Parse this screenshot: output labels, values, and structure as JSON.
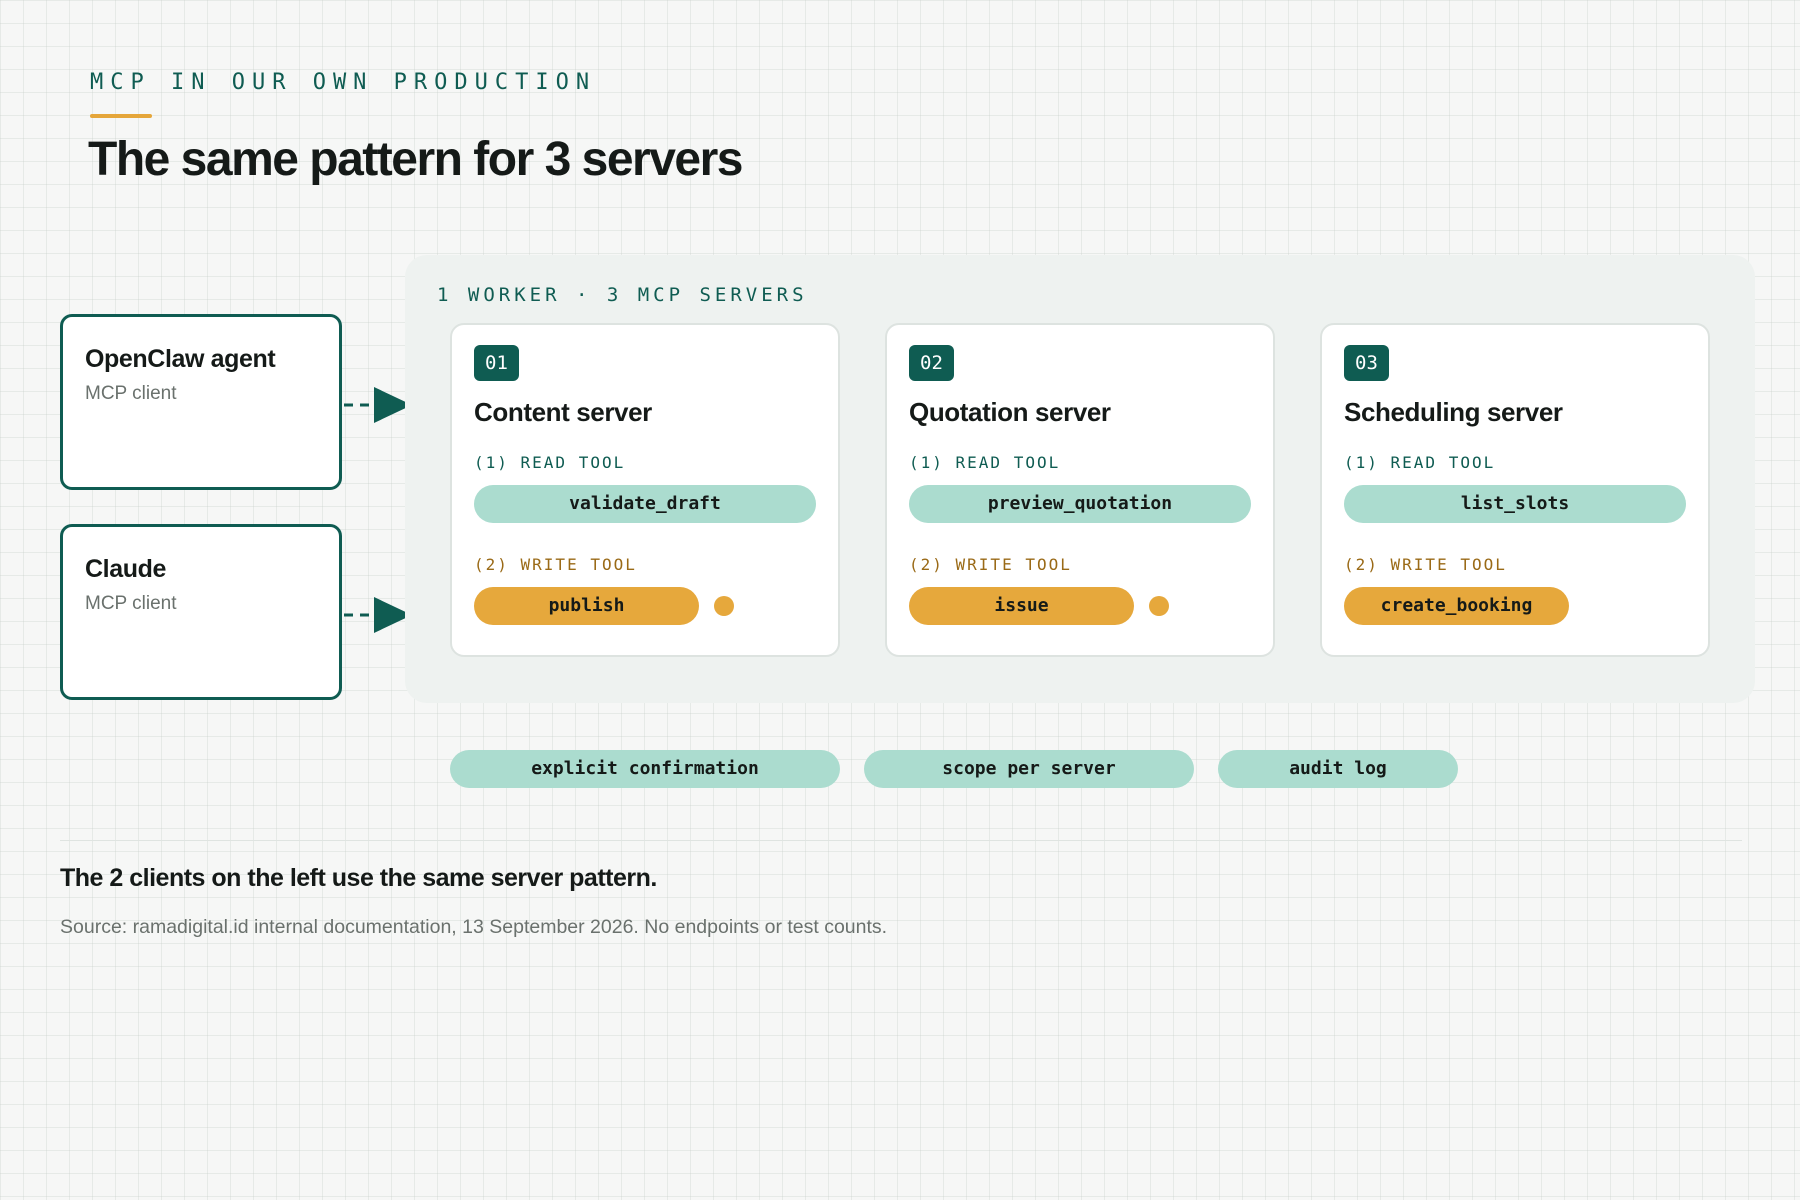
{
  "header": {
    "eyebrow": "MCP IN OUR OWN PRODUCTION",
    "title": "The same pattern for 3 servers"
  },
  "clients": [
    {
      "name": "OpenClaw agent",
      "role": "MCP client"
    },
    {
      "name": "Claude",
      "role": "MCP client"
    }
  ],
  "worker": {
    "label": "1 WORKER · 3 MCP SERVERS",
    "servers": [
      {
        "number": "01",
        "name": "Content server",
        "read_label": "(1) READ TOOL",
        "read_tool": "validate_draft",
        "write_label": "(2) WRITE TOOL",
        "write_tool": "publish",
        "write_dot": true
      },
      {
        "number": "02",
        "name": "Quotation server",
        "read_label": "(1) READ TOOL",
        "read_tool": "preview_quotation",
        "write_label": "(2) WRITE TOOL",
        "write_tool": "issue",
        "write_dot": true
      },
      {
        "number": "03",
        "name": "Scheduling server",
        "read_label": "(1) READ TOOL",
        "read_tool": "list_slots",
        "write_label": "(2) WRITE TOOL",
        "write_tool": "create_booking",
        "write_dot": false
      }
    ]
  },
  "principles": [
    "explicit confirmation",
    "scope per server",
    "audit log"
  ],
  "footer": {
    "summary": "The 2 clients on the left use the same server pattern.",
    "source": "Source: ramadigital.id internal documentation, 13 September 2026. No endpoints or test counts."
  },
  "colors": {
    "accent_teal": "#0f5c52",
    "read_pill": "#abdccf",
    "write_pill": "#e6a83c",
    "eyebrow_rule": "#e5a63a"
  },
  "icons": [
    "dashed-arrow-icon",
    "confirmation-dot-icon"
  ]
}
